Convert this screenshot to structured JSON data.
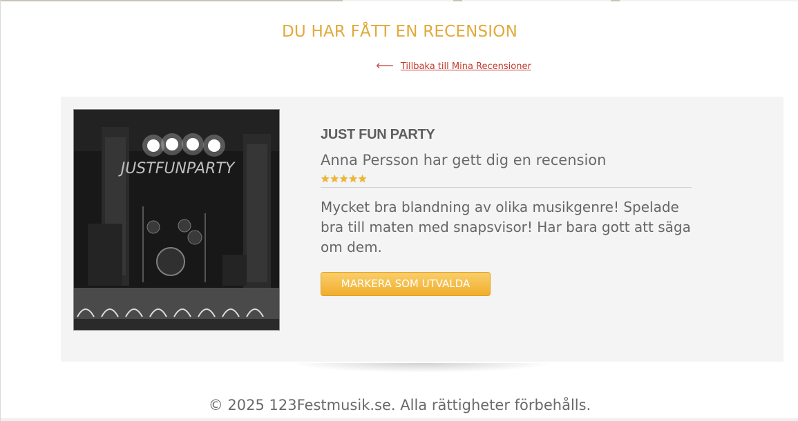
{
  "header": {
    "title": "DU HAR FÅTT EN RECENSION",
    "back_arrow": "⟵",
    "back_link": "Tillbaka till Mina Recensioner"
  },
  "review": {
    "band_name": "JUST FUN PARTY",
    "reviewer_text": "Anna Persson har gett dig en recension",
    "rating": 5,
    "rating_max": 5,
    "star_glyph": "★",
    "text": "Mycket bra blandning av olika musikgenre! Spelade bra till maten med snapsvisor! Har bara gott att säga om dem.",
    "image_banner_text": "JUSTFUNPARTY",
    "feature_button": "MARKERA SOM UTVALDA"
  },
  "footer": {
    "copyright": "© 2025 123Festmusik.se. Alla rättigheter förbehålls."
  },
  "colors": {
    "accent": "#e2a93a",
    "link": "#c0392b",
    "card_bg": "#f4f4f4",
    "text": "#666666",
    "star": "#f2b526"
  }
}
